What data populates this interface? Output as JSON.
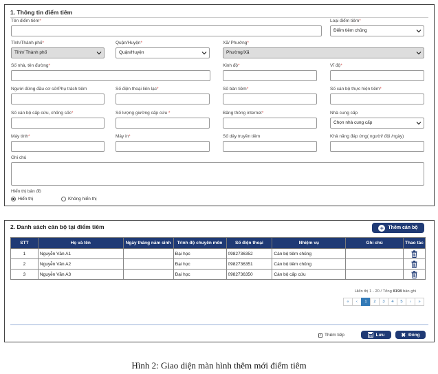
{
  "section1": {
    "title": "1. Thông tin điểm tiêm",
    "fields": {
      "ten_diem_tiem": {
        "label": "Tên điểm tiêm",
        "value": ""
      },
      "loai_diem_tiem": {
        "label": "Loại điểm tiêm",
        "value": "Điểm tiêm chủng"
      },
      "tinh": {
        "label": "Tỉnh/Thành phố",
        "value": "Tỉnh/ Thành phố"
      },
      "quan": {
        "label": "Quận/Huyện",
        "value": "Quận/Huyện"
      },
      "xa": {
        "label": "Xã/ Phường",
        "value": "Phường/Xã"
      },
      "so_nha": {
        "label": "Số nhà, tên đường",
        "value": ""
      },
      "kinh_do": {
        "label": "Kinh độ",
        "value": ""
      },
      "vi_do": {
        "label": "Vĩ độ",
        "value": ""
      },
      "nguoi_dung_dau": {
        "label": "Người đứng đầu cơ sở/Phụ trách tiêm",
        "value": ""
      },
      "sdt_lien_lac": {
        "label": "Số điện thoại liên lạc",
        "value": ""
      },
      "so_ban_tiem": {
        "label": "Số bàn tiêm",
        "value": ""
      },
      "so_can_bo_thuc_hien": {
        "label": "Số cán bộ thực hiện tiêm",
        "value": ""
      },
      "so_can_bo_cap_cuu": {
        "label": "Số cán bộ cấp cứu, chống sốc",
        "value": ""
      },
      "so_luong_giuong": {
        "label": "Số lượng giường cấp cứu",
        "value": ""
      },
      "bang_thong": {
        "label": "Băng thông internet",
        "value": ""
      },
      "nha_cung_cap": {
        "label": "Nhà cung cấp",
        "value": "Chọn nhà cung cấp"
      },
      "may_tinh": {
        "label": "Máy tính",
        "value": ""
      },
      "may_in": {
        "label": "Máy in",
        "value": ""
      },
      "so_day_truyen": {
        "label": "Số dây truyền tiêm",
        "value": ""
      },
      "kha_nang_dap_ung": {
        "label": "Khả năng đáp ứng( người/ đội /ngày)",
        "value": ""
      },
      "ghi_chu": {
        "label": "Ghi chú",
        "value": ""
      }
    },
    "hien_thi_ban_do": {
      "label": "Hiển thị bản đồ",
      "options": [
        "Hiển thị",
        "Không hiển thị"
      ],
      "selected": 0
    }
  },
  "section2": {
    "title": "2. Danh sách cán bộ tại điểm tiêm",
    "add_button": "Thêm cán bộ",
    "columns": [
      "STT",
      "Họ và tên",
      "Ngày tháng năm sinh",
      "Trình độ chuyên môn",
      "Số điện thoại",
      "Nhiệm vụ",
      "Ghi chú",
      "Thao tác"
    ],
    "rows": [
      {
        "stt": "1",
        "ho_ten": "Nguyễn Văn A1",
        "ngay_sinh": "",
        "trinh_do": "Đại học",
        "sdt": "0982736352",
        "nhiem_vu": "Cán bộ tiêm chủng",
        "ghi_chu": ""
      },
      {
        "stt": "2",
        "ho_ten": "Nguyễn Văn A2",
        "ngay_sinh": "",
        "trinh_do": "Đại học",
        "sdt": "0982736351",
        "nhiem_vu": "Cán bộ tiêm chủng",
        "ghi_chu": ""
      },
      {
        "stt": "3",
        "ho_ten": "Nguyễn Văn A3",
        "ngay_sinh": "",
        "trinh_do": "Đại học",
        "sdt": "0982736350",
        "nhiem_vu": "Cán bộ cấp cứu",
        "ghi_chu": ""
      }
    ],
    "pagination": {
      "info_prefix": "Hiển thị 1 - 20 / Tổng ",
      "total": "8198",
      "info_suffix": " bản ghi",
      "buttons": [
        "«",
        "‹",
        "1",
        "2",
        "3",
        "4",
        "5",
        "›",
        "»"
      ],
      "active": "1"
    },
    "footer": {
      "checkbox_label": "Thêm tiếp",
      "save_label": "Lưu",
      "close_label": "Đóng"
    }
  },
  "caption": "Hình 2: Giao diện màn hình thêm mới điểm tiêm",
  "colors": {
    "primary": "#1f3a75",
    "required": "#d9534f",
    "link": "#337ab7"
  }
}
